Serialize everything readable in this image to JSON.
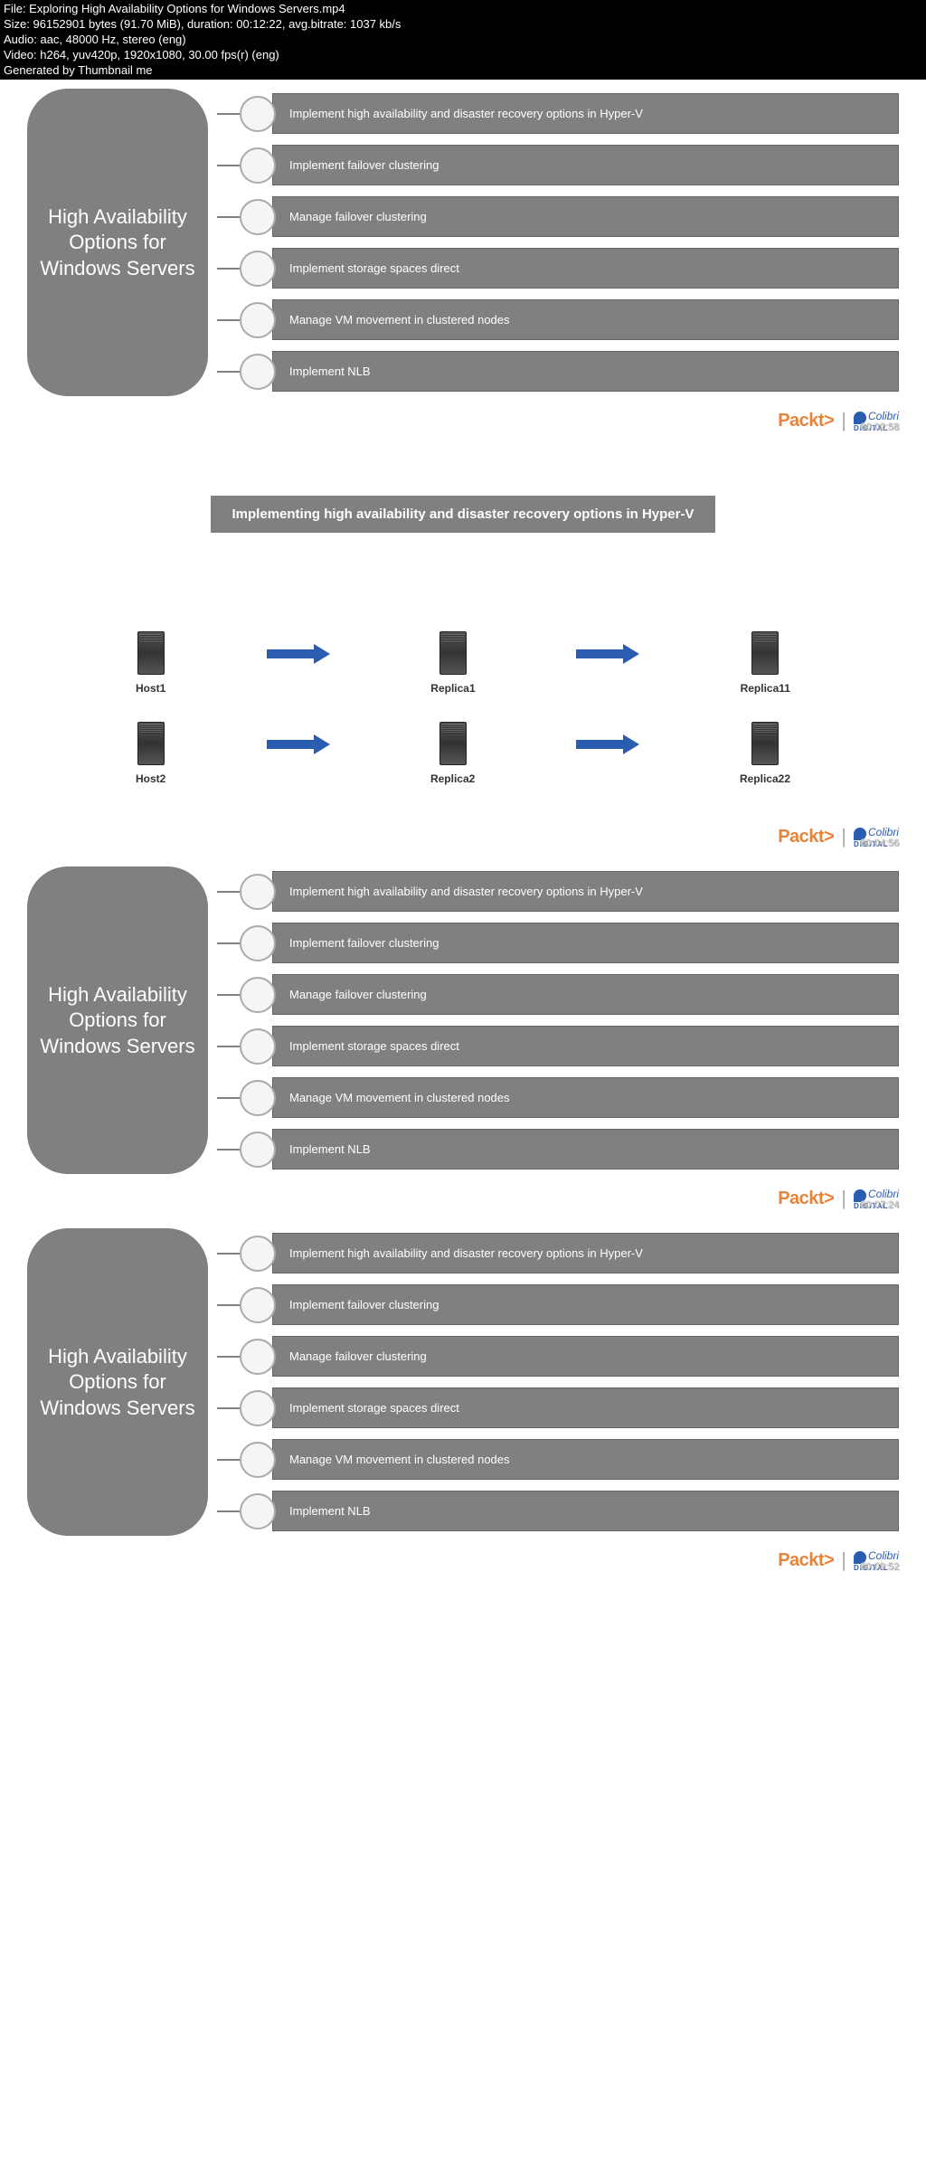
{
  "header": {
    "file": "File: Exploring High Availability Options for Windows Servers.mp4",
    "size": "Size: 96152901 bytes (91.70 MiB), duration: 00:12:22, avg.bitrate: 1037 kb/s",
    "audio": "Audio: aac, 48000 Hz, stereo (eng)",
    "video": "Video: h264, yuv420p, 1920x1080, 30.00 fps(r) (eng)",
    "generated": "Generated by Thumbnail me"
  },
  "main_title": "High Availability Options for Windows Servers",
  "items": [
    "Implement high availability and disaster recovery options in Hyper-V",
    "Implement failover clustering",
    "Manage failover clustering",
    "Implement storage spaces direct",
    "Manage VM movement in clustered nodes",
    "Implement NLB"
  ],
  "slide2_title": "Implementing high availability and disaster recovery options in Hyper-V",
  "replica": {
    "row1": [
      "Host1",
      "Replica1",
      "Replica11"
    ],
    "row2": [
      "Host2",
      "Replica2",
      "Replica22"
    ]
  },
  "brand": {
    "packt": "Packt>",
    "colibri": "Colibri",
    "digital": "DIGITAL"
  },
  "timestamps": [
    "00:02:58",
    "00:04:56",
    "00:07:24",
    "00:09:52"
  ]
}
